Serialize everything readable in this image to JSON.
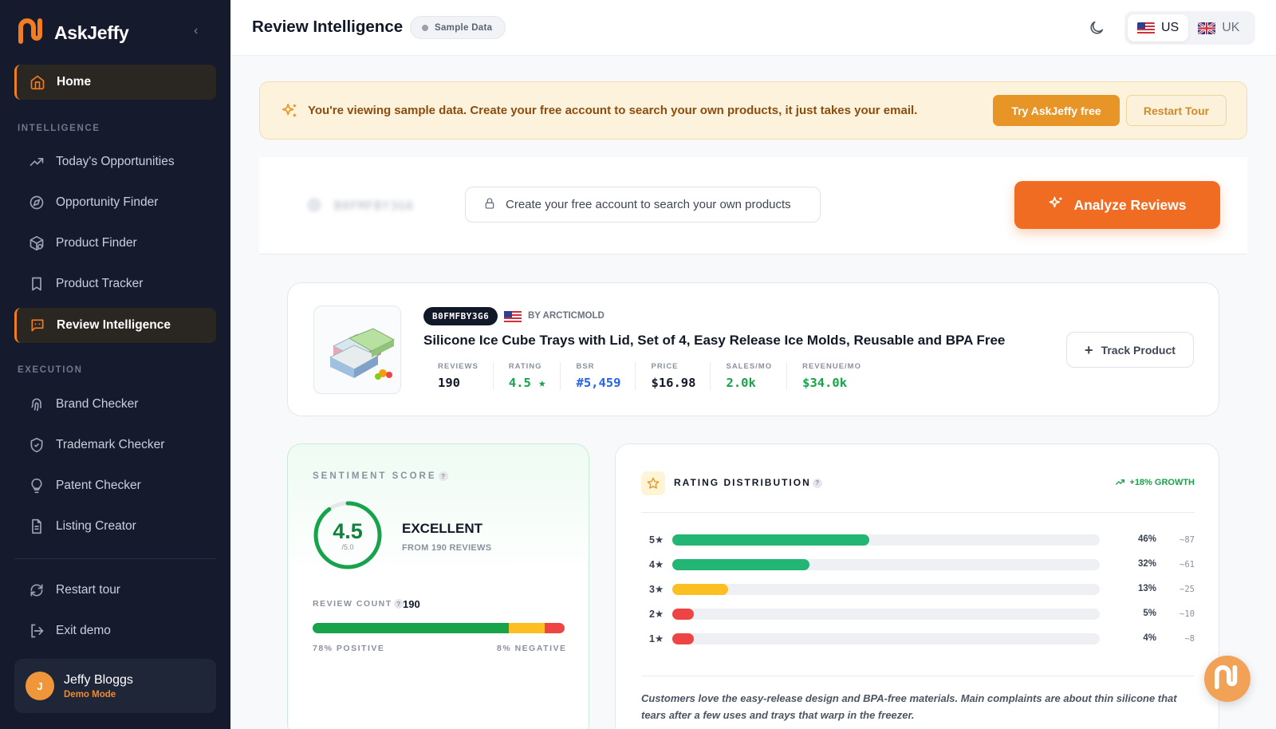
{
  "app": {
    "name": "AskJeffy",
    "logo_icon": "askjeffy-logo-icon",
    "brand_color": "#f07d22"
  },
  "sidebar": {
    "home_label": "Home",
    "intelligence_section": "INTELLIGENCE",
    "intelligence_items": [
      {
        "label": "Today's Opportunities",
        "icon": "trending-up-icon"
      },
      {
        "label": "Opportunity Finder",
        "icon": "compass-icon"
      },
      {
        "label": "Product Finder",
        "icon": "package-search-icon"
      },
      {
        "label": "Product Tracker",
        "icon": "bookmark-icon"
      },
      {
        "label": "Review Intelligence",
        "icon": "message-square-icon",
        "active": true
      }
    ],
    "execution_section": "EXECUTION",
    "execution_items": [
      {
        "label": "Brand Checker",
        "icon": "fingerprint-icon"
      },
      {
        "label": "Trademark Checker",
        "icon": "shield-check-icon"
      },
      {
        "label": "Patent Checker",
        "icon": "lightbulb-icon"
      },
      {
        "label": "Listing Creator",
        "icon": "file-text-icon"
      }
    ],
    "footer_items": [
      {
        "label": "Restart tour",
        "icon": "refresh-icon"
      },
      {
        "label": "Exit demo",
        "icon": "log-out-icon"
      }
    ],
    "user": {
      "name": "Jeffy Bloggs",
      "initial": "J",
      "mode": "Demo Mode"
    }
  },
  "header": {
    "title": "Review Intelligence",
    "badge": "Sample Data",
    "regions": [
      {
        "code": "US",
        "active": true
      },
      {
        "code": "UK",
        "active": false
      }
    ]
  },
  "banner": {
    "message": "You're viewing sample data. Create your free account to search your own products, it just takes your email.",
    "primary_button": "Try AskJeffy free",
    "secondary_button": "Restart Tour"
  },
  "search": {
    "asin_placeholder": "B0FMFBY3G6",
    "locked_message": "Create your free account to search your own products",
    "analyze_button": "Analyze Reviews"
  },
  "product": {
    "asin": "B0FMFBY3G6",
    "brand": "BY ARCTICMOLD",
    "title": "Silicone Ice Cube Trays with Lid, Set of 4, Easy Release Ice Molds, Reusable and BPA Free",
    "stats": [
      {
        "label": "REVIEWS",
        "value": "190",
        "color": "#111827"
      },
      {
        "label": "RATING",
        "value": "4.5 ★",
        "color": "#16a34a"
      },
      {
        "label": "BSR",
        "value": "#5,459",
        "color": "#2563eb"
      },
      {
        "label": "PRICE",
        "value": "$16.98",
        "color": "#111827"
      },
      {
        "label": "SALES/MO",
        "value": "2.0k",
        "color": "#16a34a"
      },
      {
        "label": "REVENUE/MO",
        "value": "$34.0k",
        "color": "#16a34a"
      }
    ],
    "track_button": "Track Product"
  },
  "sentiment": {
    "label": "SENTIMENT SCORE",
    "score": "4.5",
    "score_max": "/5.0",
    "score_fraction": 0.9,
    "verdict": "EXCELLENT",
    "verdict_sub": "FROM 190 REVIEWS",
    "review_count_label": "REVIEW COUNT",
    "review_count": "190",
    "positive_pct": 78,
    "neutral_pct": 14,
    "negative_pct": 8,
    "positive_label": "78% POSITIVE",
    "negative_label": "8% NEGATIVE",
    "colors": {
      "positive": "#16a34a",
      "neutral": "#fbbf24",
      "negative": "#ef4444"
    }
  },
  "distribution": {
    "title": "RATING DISTRIBUTION",
    "growth": "+18% GROWTH",
    "rows": [
      {
        "stars": "5★",
        "pct": 46,
        "pct_label": "46%",
        "count": "~87",
        "color": "#22b573"
      },
      {
        "stars": "4★",
        "pct": 32,
        "pct_label": "32%",
        "count": "~61",
        "color": "#22b573"
      },
      {
        "stars": "3★",
        "pct": 13,
        "pct_label": "13%",
        "count": "~25",
        "color": "#fbbf24"
      },
      {
        "stars": "2★",
        "pct": 5,
        "pct_label": "5%",
        "count": "~10",
        "color": "#ef4444"
      },
      {
        "stars": "1★",
        "pct": 4,
        "pct_label": "4%",
        "count": "~8",
        "color": "#ef4444"
      }
    ],
    "summary": "Customers love the easy-release design and BPA-free materials. Main complaints are about thin silicone that tears after a few uses and trays that warp in the freezer."
  }
}
